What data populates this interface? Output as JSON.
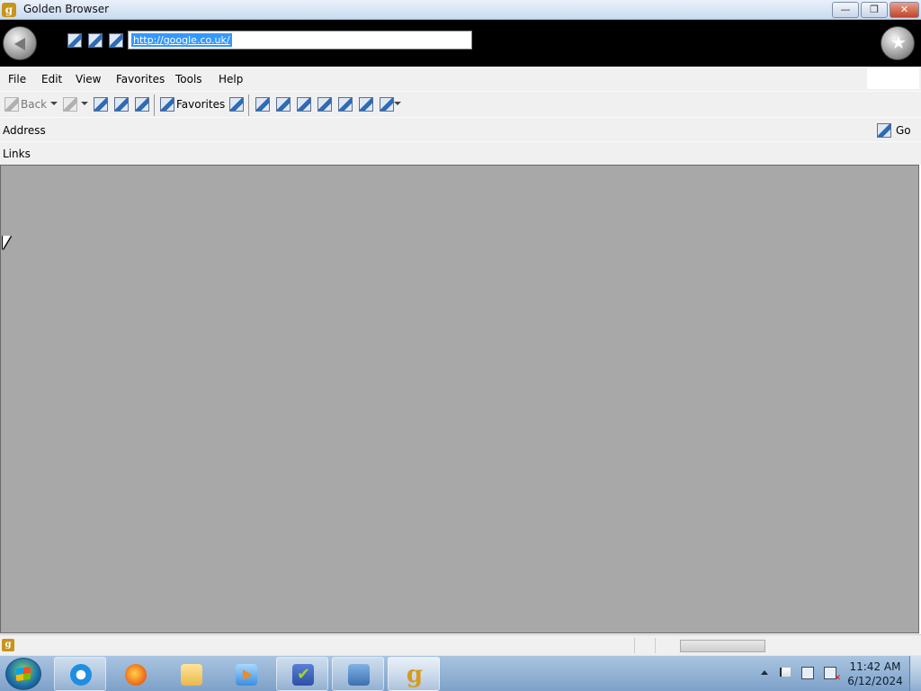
{
  "window": {
    "title": "Golden Browser",
    "app_icon_glyph": "g",
    "controls": {
      "minimize": "—",
      "maximize": "❐",
      "close": "✕"
    }
  },
  "header": {
    "url": "http://google.co.uk/",
    "icons": [
      "back-orb-icon",
      "image-icon",
      "image-icon",
      "image-icon",
      "favorites-star-icon"
    ]
  },
  "menu": {
    "items": [
      "File",
      "Edit",
      "View",
      "Favorites",
      "Tools",
      "Help"
    ]
  },
  "toolbar": {
    "back_label": "Back",
    "favorites_label": "Favorites"
  },
  "address_bar": {
    "label": "Address",
    "go_label": "Go"
  },
  "links_bar": {
    "label": "Links"
  },
  "status_bar": {
    "icon_glyph": "g"
  },
  "taskbar": {
    "pinned": [
      "start-orb-icon",
      "internet-explorer-icon",
      "firefox-icon",
      "file-explorer-icon",
      "media-player-icon",
      "checklist-app-icon",
      "network-app-icon",
      "golden-browser-icon"
    ],
    "clock_time": "11:42 AM",
    "clock_date": "6/12/2024"
  },
  "colors": {
    "content_background": "#a8a8a8",
    "header_background": "#000000",
    "url_selection": "#3399ff",
    "brand_gold": "#c8941a"
  }
}
